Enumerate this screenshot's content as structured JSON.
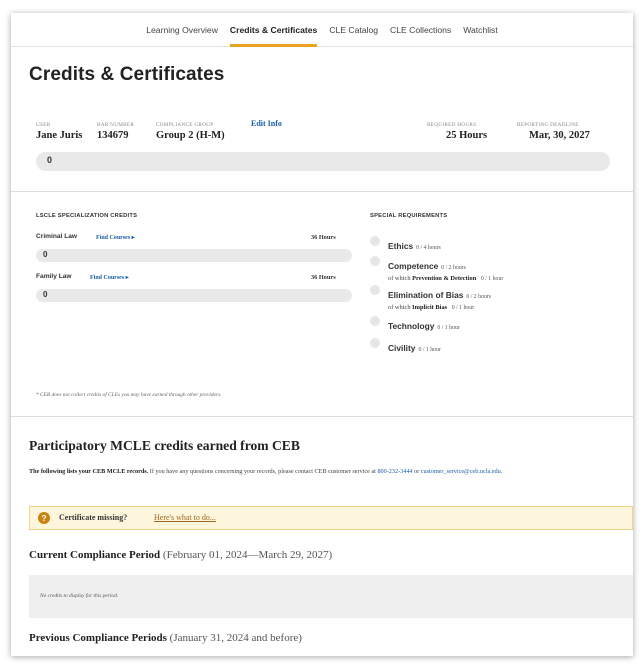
{
  "nav": {
    "tabs": [
      {
        "label": "Learning Overview"
      },
      {
        "label": "Credits & Certificates"
      },
      {
        "label": "CLE Catalog"
      },
      {
        "label": "CLE Collections"
      },
      {
        "label": "Watchlist"
      }
    ],
    "active_index": 1,
    "accent_color": "#e9a321"
  },
  "page": {
    "title": "Credits & Certificates"
  },
  "user_info": {
    "user_label": "USER",
    "user_value": "Jane Juris",
    "bar_label": "BAR NUMBER",
    "bar_value": "134679",
    "group_label": "COMPLIANCE GROUP",
    "group_value": "Group 2 (H-M)",
    "edit_label": "Edit Info",
    "required_label": "REQUIRED HOURS",
    "required_value": "25 Hours",
    "deadline_label": "REPORTING DEADLINE",
    "deadline_value": "Mar, 30, 2027",
    "progress_value": "0"
  },
  "specialization": {
    "heading": "LSCLE SPECIALIZATION CREDITS",
    "items": [
      {
        "name": "Criminal Law",
        "link": "Find Courses ▸",
        "hours": "36 Hours",
        "progress": "0"
      },
      {
        "name": "Family Law",
        "link": "Find Courses ▸",
        "hours": "36 Hours",
        "progress": "0"
      }
    ]
  },
  "special_requirements": {
    "heading": "SPECIAL REQUIREMENTS",
    "items": [
      {
        "name": "Ethics",
        "amount": "0 / 4 hours"
      },
      {
        "name": "Competence",
        "amount": "0 / 2 hours",
        "sub_prefix": "of which",
        "sub_name": "Prevention & Detection",
        "sub_amount": "0 / 1 hour"
      },
      {
        "name": "Elimination of Bias",
        "amount": "0 / 2 hours",
        "sub_prefix": "of which",
        "sub_name": "Implicit Bias",
        "sub_amount": "0 / 1 hour"
      },
      {
        "name": "Technology",
        "amount": "0 / 1 hour"
      },
      {
        "name": "Civility",
        "amount": "0 / 1 hour"
      }
    ]
  },
  "footnote": "* CEB does not collect credits of CLEs you may have earned through other providers.",
  "participatory": {
    "title": "Participatory MCLE credits earned from CEB",
    "intro_bold": "The following lists your CEB MCLE records.",
    "intro_text": " If you have any questions concerning your records, please contact CEB customer service at ",
    "phone": "800-232-3444",
    "or_text": " or ",
    "email": "customer_service@ceb.ucla.edu",
    "end": "."
  },
  "alert": {
    "icon": "?",
    "title": "Certificate missing?",
    "link": "Here's what to do..."
  },
  "current_period": {
    "label": "Current Compliance Period",
    "range": " (February 01, 2024—March 29, 2027)",
    "empty_text": "No credits to display for this period."
  },
  "previous_period": {
    "label": "Previous Compliance Periods",
    "range": " (January 31, 2024 and before)"
  }
}
